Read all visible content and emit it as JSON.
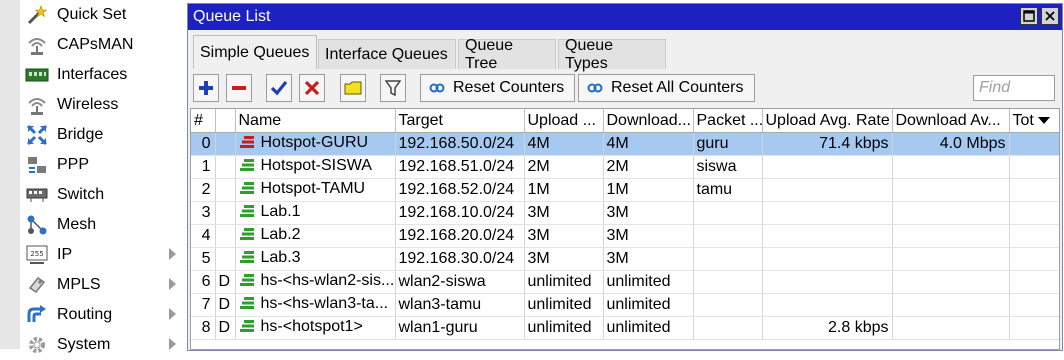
{
  "sidebar": {
    "items": [
      {
        "label": "Quick Set",
        "icon": "wand-icon",
        "submenu": false
      },
      {
        "label": "CAPsMAN",
        "icon": "capsman-icon",
        "submenu": false
      },
      {
        "label": "Interfaces",
        "icon": "interfaces-icon",
        "submenu": false
      },
      {
        "label": "Wireless",
        "icon": "wireless-icon",
        "submenu": false
      },
      {
        "label": "Bridge",
        "icon": "bridge-icon",
        "submenu": false
      },
      {
        "label": "PPP",
        "icon": "ppp-icon",
        "submenu": false
      },
      {
        "label": "Switch",
        "icon": "switch-icon",
        "submenu": false
      },
      {
        "label": "Mesh",
        "icon": "mesh-icon",
        "submenu": false
      },
      {
        "label": "IP",
        "icon": "ip-icon",
        "submenu": true
      },
      {
        "label": "MPLS",
        "icon": "mpls-icon",
        "submenu": true
      },
      {
        "label": "Routing",
        "icon": "routing-icon",
        "submenu": true
      },
      {
        "label": "System",
        "icon": "system-icon",
        "submenu": true
      }
    ]
  },
  "window": {
    "title": "Queue List",
    "tabs": [
      {
        "label": "Simple Queues",
        "active": true
      },
      {
        "label": "Interface Queues",
        "active": false
      },
      {
        "label": "Queue Tree",
        "active": false
      },
      {
        "label": "Queue Types",
        "active": false
      }
    ],
    "toolbar": {
      "reset_counters": "Reset Counters",
      "reset_all_counters": "Reset All Counters",
      "find_placeholder": "Find"
    }
  },
  "table": {
    "columns": [
      "#",
      "",
      "Name",
      "Target",
      "Upload ...",
      "Download...",
      "Packet ...",
      "Upload Avg. Rate",
      "Download Av...",
      "Tot"
    ],
    "rows": [
      {
        "num": "0",
        "flag": "",
        "name": "Hotspot-GURU",
        "target": "192.168.50.0/24",
        "upload": "4M",
        "download": "4M",
        "packet": "guru",
        "up_avg": "71.4 kbps",
        "down_avg": "4.0 Mbps",
        "tot": "",
        "selected": true,
        "icon": "red"
      },
      {
        "num": "1",
        "flag": "",
        "name": "Hotspot-SISWA",
        "target": "192.168.51.0/24",
        "upload": "2M",
        "download": "2M",
        "packet": "siswa",
        "up_avg": "",
        "down_avg": "",
        "tot": "",
        "selected": false,
        "icon": "green"
      },
      {
        "num": "2",
        "flag": "",
        "name": "Hotspot-TAMU",
        "target": "192.168.52.0/24",
        "upload": "1M",
        "download": "1M",
        "packet": "tamu",
        "up_avg": "",
        "down_avg": "",
        "tot": "",
        "selected": false,
        "icon": "green"
      },
      {
        "num": "3",
        "flag": "",
        "name": "Lab.1",
        "target": "192.168.10.0/24",
        "upload": "3M",
        "download": "3M",
        "packet": "",
        "up_avg": "",
        "down_avg": "",
        "tot": "",
        "selected": false,
        "icon": "green"
      },
      {
        "num": "4",
        "flag": "",
        "name": "Lab.2",
        "target": "192.168.20.0/24",
        "upload": "3M",
        "download": "3M",
        "packet": "",
        "up_avg": "",
        "down_avg": "",
        "tot": "",
        "selected": false,
        "icon": "green"
      },
      {
        "num": "5",
        "flag": "",
        "name": "Lab.3",
        "target": "192.168.30.0/24",
        "upload": "3M",
        "download": "3M",
        "packet": "",
        "up_avg": "",
        "down_avg": "",
        "tot": "",
        "selected": false,
        "icon": "green"
      },
      {
        "num": "6",
        "flag": "D",
        "name": "hs-<hs-wlan2-sis...",
        "target": "wlan2-siswa",
        "upload": "unlimited",
        "download": "unlimited",
        "packet": "",
        "up_avg": "",
        "down_avg": "",
        "tot": "",
        "selected": false,
        "icon": "green"
      },
      {
        "num": "7",
        "flag": "D",
        "name": "hs-<hs-wlan3-ta...",
        "target": "wlan3-tamu",
        "upload": "unlimited",
        "download": "unlimited",
        "packet": "",
        "up_avg": "",
        "down_avg": "",
        "tot": "",
        "selected": false,
        "icon": "green"
      },
      {
        "num": "8",
        "flag": "D",
        "name": "hs-<hotspot1>",
        "target": "wlan1-guru",
        "upload": "unlimited",
        "download": "unlimited",
        "packet": "",
        "up_avg": "2.8 kbps",
        "down_avg": "",
        "tot": "",
        "selected": false,
        "icon": "green"
      }
    ]
  },
  "colors": {
    "titlebar": "#1e21c2",
    "selected_row": "#a6c9f2",
    "queue_green": "#2e9e2e",
    "queue_red": "#b82424"
  }
}
